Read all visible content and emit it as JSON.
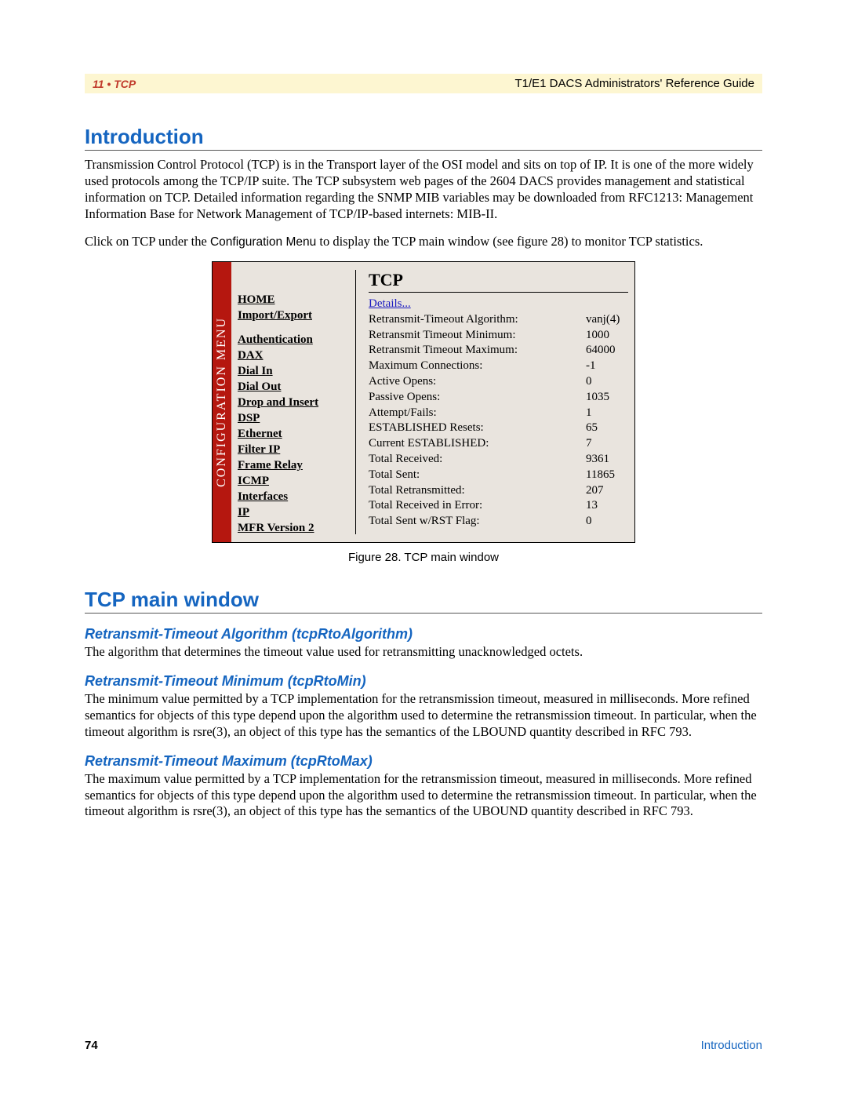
{
  "header": {
    "chapter": "11 • TCP",
    "doc_title": "T1/E1 DACS Administrators' Reference Guide"
  },
  "h1_intro": "Introduction",
  "intro_p1": "Transmission Control Protocol (TCP) is in the Transport layer of the OSI model and sits on top of IP.  It is one of  the more widely used protocols among the TCP/IP suite. The TCP subsystem web pages of the 2604 DACS provides management and statistical information on TCP. Detailed information regarding the SNMP MIB variables may be downloaded from RFC1213: Management Information Base for Network Management of TCP/IP-based internets: MIB-II.",
  "intro_p2a": "Click on TCP under the ",
  "intro_p2_menu": "Configuration Menu",
  "intro_p2b": " to display the TCP main window (see figure 28) to monitor TCP statistics.",
  "figure": {
    "menu_label": "CONFIGURATION MENU",
    "menu_items": [
      {
        "label": "HOME",
        "bold": true
      },
      {
        "label": "Import/Export",
        "bold": true
      },
      {
        "label": "Authentication",
        "bold": true
      },
      {
        "label": "DAX",
        "bold": true
      },
      {
        "label": "Dial In",
        "bold": true
      },
      {
        "label": "Dial Out",
        "bold": true
      },
      {
        "label": "Drop and Insert",
        "bold": true
      },
      {
        "label": "DSP",
        "bold": true
      },
      {
        "label": "Ethernet",
        "bold": true
      },
      {
        "label": "Filter IP",
        "bold": true
      },
      {
        "label": "Frame Relay",
        "bold": true
      },
      {
        "label": "ICMP",
        "bold": true
      },
      {
        "label": "Interfaces",
        "bold": true
      },
      {
        "label": "IP",
        "bold": true
      },
      {
        "label": "MFR Version 2",
        "bold": true
      }
    ],
    "panel_title": "TCP",
    "details_link": "Details...",
    "rows": [
      {
        "label": "Retransmit-Timeout Algorithm:",
        "value": "vanj(4)"
      },
      {
        "label": "Retransmit Timeout Minimum:",
        "value": "1000"
      },
      {
        "label": "Retransmit Timeout Maximum:",
        "value": "64000"
      },
      {
        "label": "Maximum Connections:",
        "value": "-1"
      },
      {
        "label": "Active Opens:",
        "value": "0"
      },
      {
        "label": "Passive Opens:",
        "value": "1035"
      },
      {
        "label": "Attempt/Fails:",
        "value": "1"
      },
      {
        "label": "ESTABLISHED Resets:",
        "value": "65"
      },
      {
        "label": "Current ESTABLISHED:",
        "value": "7"
      },
      {
        "label": "Total Received:",
        "value": "9361"
      },
      {
        "label": "Total Sent:",
        "value": "11865"
      },
      {
        "label": "Total Retransmitted:",
        "value": "207"
      },
      {
        "label": "Total Received in Error:",
        "value": "13"
      },
      {
        "label": "Total Sent w/RST Flag:",
        "value": "0"
      }
    ],
    "caption": "Figure 28. TCP main window"
  },
  "h1_tcp": "TCP main window",
  "sections": [
    {
      "heading": "Retransmit-Timeout Algorithm (tcpRtoAlgorithm)",
      "body": "The algorithm that determines the timeout value used for retransmitting unacknowledged octets."
    },
    {
      "heading": "Retransmit-Timeout Minimum (tcpRtoMin)",
      "body": "The minimum value permitted by a TCP implementation for the retransmission timeout, measured in milliseconds. More refined semantics for objects of this type depend upon the algorithm used to determine the retransmission timeout. In particular, when the timeout algorithm is rsre(3), an object of this type has the semantics of the LBOUND quantity described in RFC 793."
    },
    {
      "heading": "Retransmit-Timeout Maximum (tcpRtoMax)",
      "body": "The maximum value permitted by a TCP implementation for the retransmission timeout, measured in milliseconds. More refined semantics for objects of this type depend upon the algorithm used to determine the retransmission timeout. In particular, when the timeout algorithm is rsre(3), an object of this type has the semantics of the UBOUND quantity described in RFC 793."
    }
  ],
  "footer": {
    "page_number": "74",
    "link": "Introduction"
  }
}
